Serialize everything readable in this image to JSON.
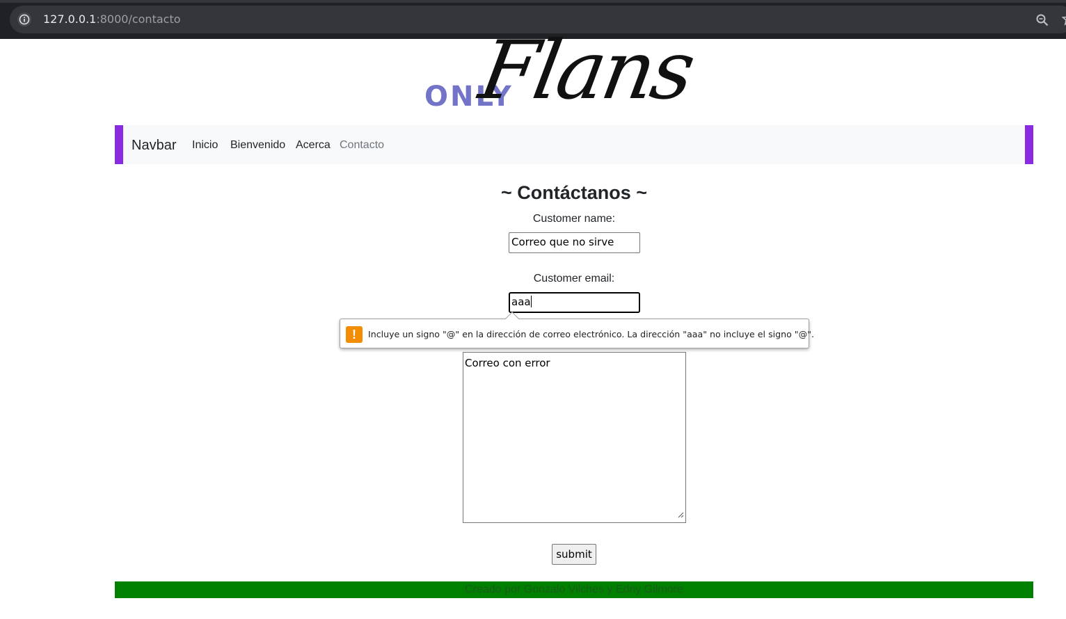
{
  "browser": {
    "url_host": "127.0.0.1",
    "url_rest": ":8000/contacto"
  },
  "logo": {
    "only": "ONLY",
    "flans": "Flans",
    "only_color": "#7373c8"
  },
  "navbar": {
    "brand": "Navbar",
    "links": [
      "Inicio",
      "Bienvenido",
      "Acerca",
      "Contacto"
    ],
    "accent_color": "#8a2be2"
  },
  "form": {
    "title": "~ Contáctanos ~",
    "name_label": "Customer name:",
    "name_value": "Correo que no sirve",
    "email_label": "Customer email:",
    "email_value": "aaa",
    "message_value": "Correo con error",
    "submit_label": "submit"
  },
  "validation": {
    "message": "Incluye un signo \"@\" en la dirección de correo electrónico. La dirección \"aaa\" no incluye el signo \"@\".",
    "icon": "warning-icon",
    "icon_color": "#f28c00"
  },
  "footer": {
    "text": "Creado por Gonzalo Vilches y Edny Gilmore",
    "color": "#008000"
  }
}
